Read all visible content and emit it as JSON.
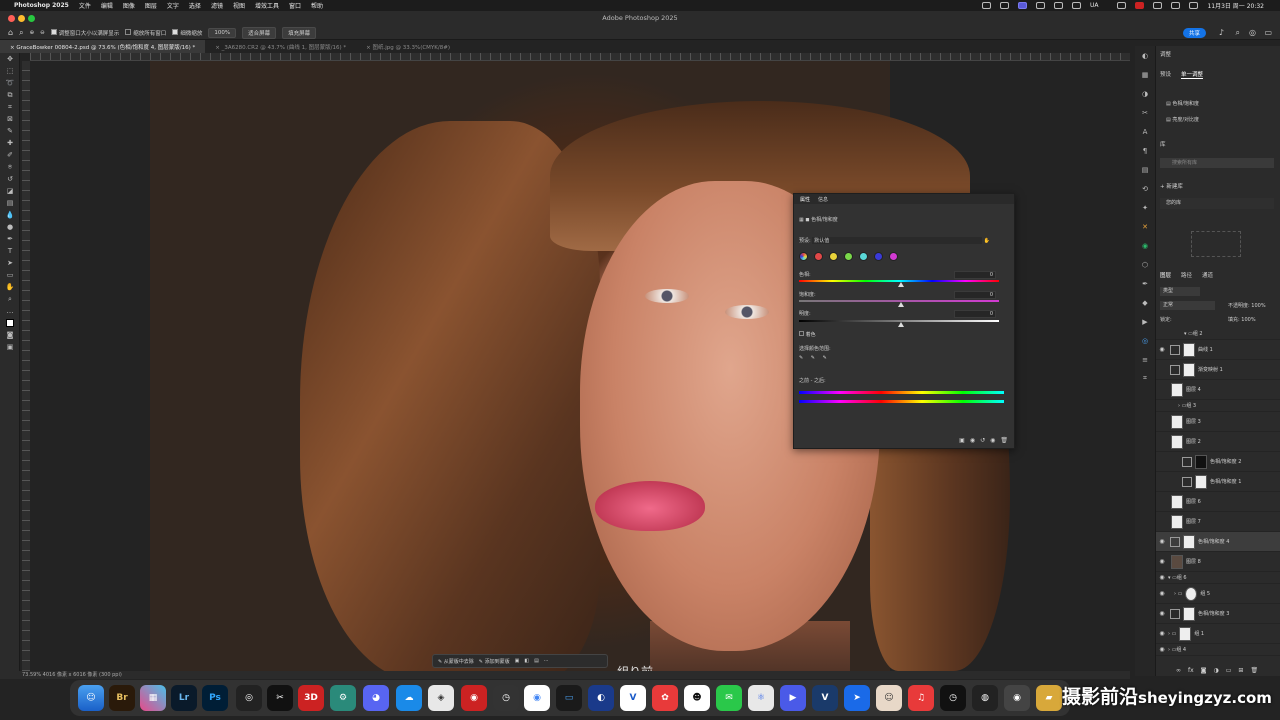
{
  "menubar": {
    "app": "Photoshop 2025",
    "items": [
      "文件",
      "编辑",
      "图像",
      "图层",
      "文字",
      "选择",
      "滤镜",
      "视图",
      "增效工具",
      "窗口",
      "帮助"
    ],
    "status_text": "UA",
    "clock": "11月3日 周一 20:32"
  },
  "window": {
    "title": "Adobe Photoshop 2025"
  },
  "options": {
    "resize_label": "调整窗口大小以满屏显示",
    "zoom_all_label": "缩放所有窗口",
    "scrubby_label": "细微缩放",
    "zoom_value": "100%",
    "fit_label": "适合屏幕",
    "fill_label": "填充屏幕",
    "share_label": "共享"
  },
  "tabs": [
    {
      "label": "GraceBowker 00804-2.psd @ 73.6% (色相/饱和度 4, 图层蒙版/16) *"
    },
    {
      "label": "_3A6280.CR2 @ 43.7% (曲线 1, 图层蒙版/16) *"
    },
    {
      "label": "图纸.jpg @ 33.3%(CMYK/8#)"
    }
  ],
  "status": {
    "text": "73.59%   4016 像素 x 6016 像素 (300 ppi)"
  },
  "context_bar": {
    "btn1": "从蒙版中去除",
    "btn2": "添加到蒙版"
  },
  "caption": {
    "text": "組り前一"
  },
  "properties": {
    "tab1": "属性",
    "tab2": "信息",
    "title": "色相/饱和度",
    "preset_label": "预设:",
    "preset_value": "默认值",
    "hue_label": "色相:",
    "hue_value": "0",
    "sat_label": "饱和度:",
    "sat_value": "0",
    "light_label": "明度:",
    "light_value": "0",
    "colorize_label": "着色",
    "range_label": "选择颜色范围:",
    "before_after_label": "之前 - 之后:",
    "swatch_colors": [
      "#e04848",
      "#e8d23a",
      "#7ad84a",
      "#5ad8d8",
      "#3a3ad8",
      "#d23ad2"
    ]
  },
  "adjust_panel": {
    "title": "调整",
    "tab1": "预设",
    "tab2": "单一调整",
    "item1": "色相/饱和度",
    "item2": "亮度/对比度"
  },
  "library_panel": {
    "title": "库",
    "search_placeholder": "搜索所有库",
    "new_lib": "新建库",
    "my_lib": "您的库"
  },
  "layers_panel": {
    "tabs": [
      "图层",
      "路径",
      "通道"
    ],
    "kind_label": "类型",
    "blend_mode": "正常",
    "opacity_label": "不透明度:",
    "opacity_value": "100%",
    "lock_label": "锁定:",
    "fill_label": "填充:",
    "fill_value": "100%",
    "layers": [
      {
        "name": "组 2"
      },
      {
        "name": "曲线 1"
      },
      {
        "name": "渐变映射 1"
      },
      {
        "name": "图层 4"
      },
      {
        "name": "组 3"
      },
      {
        "name": "图层 3"
      },
      {
        "name": "图层 2"
      },
      {
        "name": "色相/饱和度 2"
      },
      {
        "name": "色相/饱和度 1"
      },
      {
        "name": "图层 6"
      },
      {
        "name": "图层 7"
      },
      {
        "name": "色相/饱和度 4"
      },
      {
        "name": "图层 8"
      },
      {
        "name": "组 6"
      },
      {
        "name": "组 5"
      },
      {
        "name": "色相/饱和度 3"
      },
      {
        "name": "组 1"
      },
      {
        "name": "组 4"
      }
    ]
  },
  "dock": {
    "apps": [
      "Br",
      "Lr",
      "Ps"
    ]
  },
  "watermark": {
    "cn": "摄影前沿",
    "url": "sheyingzyz.com"
  }
}
